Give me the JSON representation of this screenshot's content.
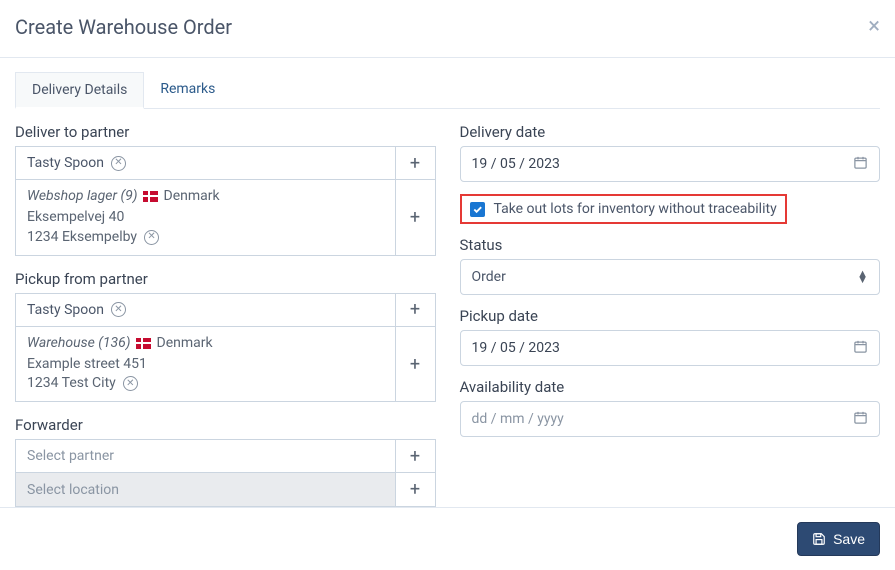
{
  "header": {
    "title": "Create Warehouse Order"
  },
  "tabs": {
    "delivery_details": "Delivery Details",
    "remarks": "Remarks"
  },
  "deliver": {
    "label": "Deliver to partner",
    "partner": "Tasty Spoon",
    "loc_name": "Webshop lager (9)",
    "loc_country": "Denmark",
    "loc_street": "Eksempelvej 40",
    "loc_city": "1234 Eksempelby"
  },
  "pickup": {
    "label": "Pickup from partner",
    "partner": "Tasty Spoon",
    "loc_name": "Warehouse (136)",
    "loc_country": "Denmark",
    "loc_street": "Example street 451",
    "loc_city": "1234 Test City"
  },
  "forwarder": {
    "label": "Forwarder",
    "partner_placeholder": "Select partner",
    "location_placeholder": "Select location"
  },
  "delivery_date": {
    "label": "Delivery date",
    "value": "19 / 05 / 2023"
  },
  "traceability": {
    "label": "Take out lots for inventory without traceability"
  },
  "status": {
    "label": "Status",
    "value": "Order"
  },
  "pickup_date": {
    "label": "Pickup date",
    "value": "19 / 05 / 2023"
  },
  "availability_date": {
    "label": "Availability date",
    "placeholder": "dd / mm / yyyy"
  },
  "footer": {
    "save": "Save"
  }
}
